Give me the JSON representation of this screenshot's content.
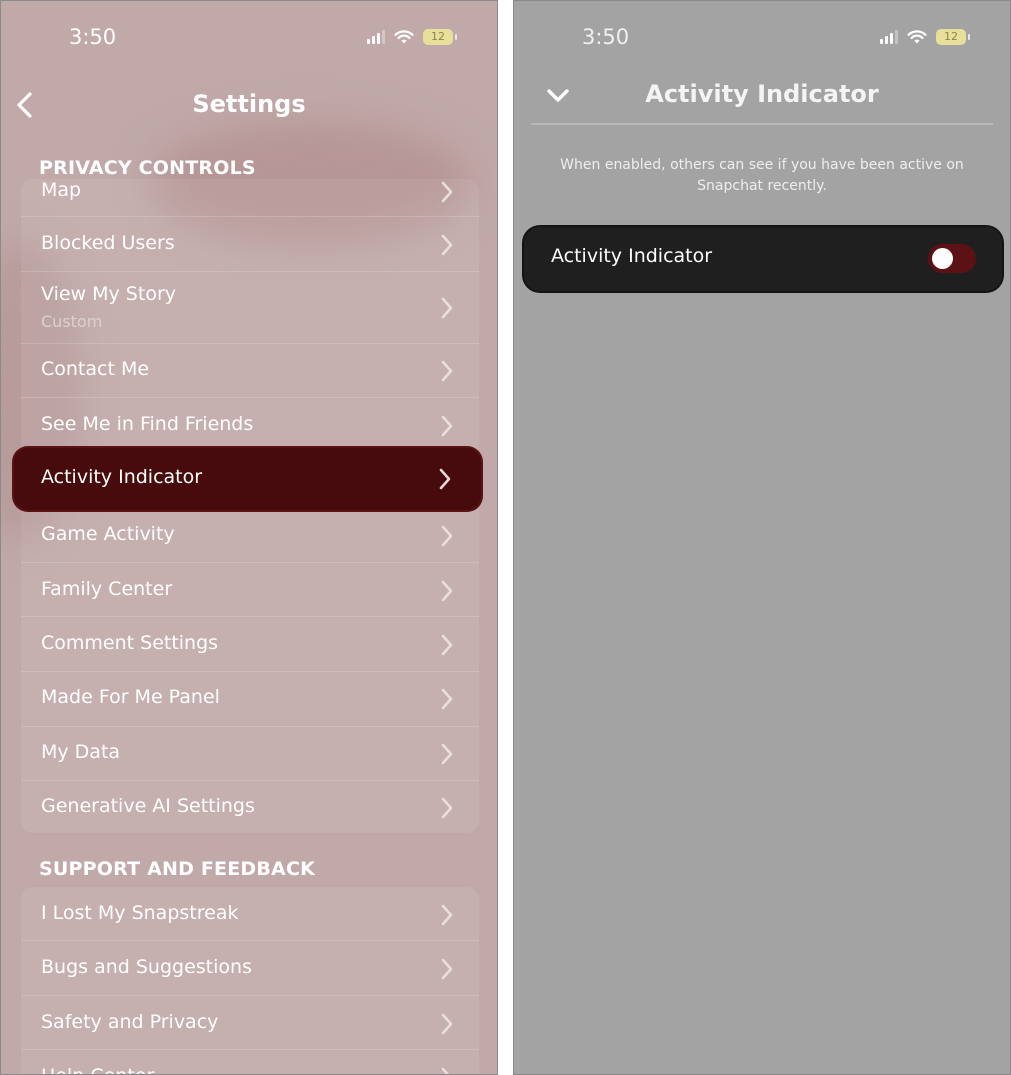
{
  "left_screen": {
    "status_bar": {
      "time": "3:50",
      "battery": "12"
    },
    "header": {
      "title": "Settings"
    },
    "privacy_section": {
      "title": "PRIVACY CONTROLS",
      "items": [
        {
          "label": "Map"
        },
        {
          "label": "Blocked Users"
        },
        {
          "label": "View My Story",
          "sublabel": "Custom"
        },
        {
          "label": "Contact Me"
        },
        {
          "label": "See Me in Find Friends"
        },
        {
          "label": "Activity Indicator",
          "highlighted": true
        },
        {
          "label": "Game Activity"
        },
        {
          "label": "Family Center"
        },
        {
          "label": "Comment Settings"
        },
        {
          "label": "Made For Me Panel"
        },
        {
          "label": "My Data"
        },
        {
          "label": "Generative AI Settings"
        }
      ]
    },
    "support_section": {
      "title": "SUPPORT AND FEEDBACK",
      "items": [
        {
          "label": "I Lost My Snapstreak"
        },
        {
          "label": "Bugs and Suggestions"
        },
        {
          "label": "Safety and Privacy"
        },
        {
          "label": "Help Center"
        }
      ]
    }
  },
  "right_screen": {
    "status_bar": {
      "time": "3:50",
      "battery": "12"
    },
    "header": {
      "title": "Activity Indicator"
    },
    "description": "When enabled, others can see if you have been active on Snapchat recently.",
    "setting": {
      "label": "Activity Indicator",
      "enabled": false
    }
  },
  "colors": {
    "left_background": "#c1a9a9",
    "right_background": "#a3a3a3",
    "highlight": "#470b0e",
    "toggle_off_track": "#5c1114",
    "card": "#1f1f1f"
  }
}
